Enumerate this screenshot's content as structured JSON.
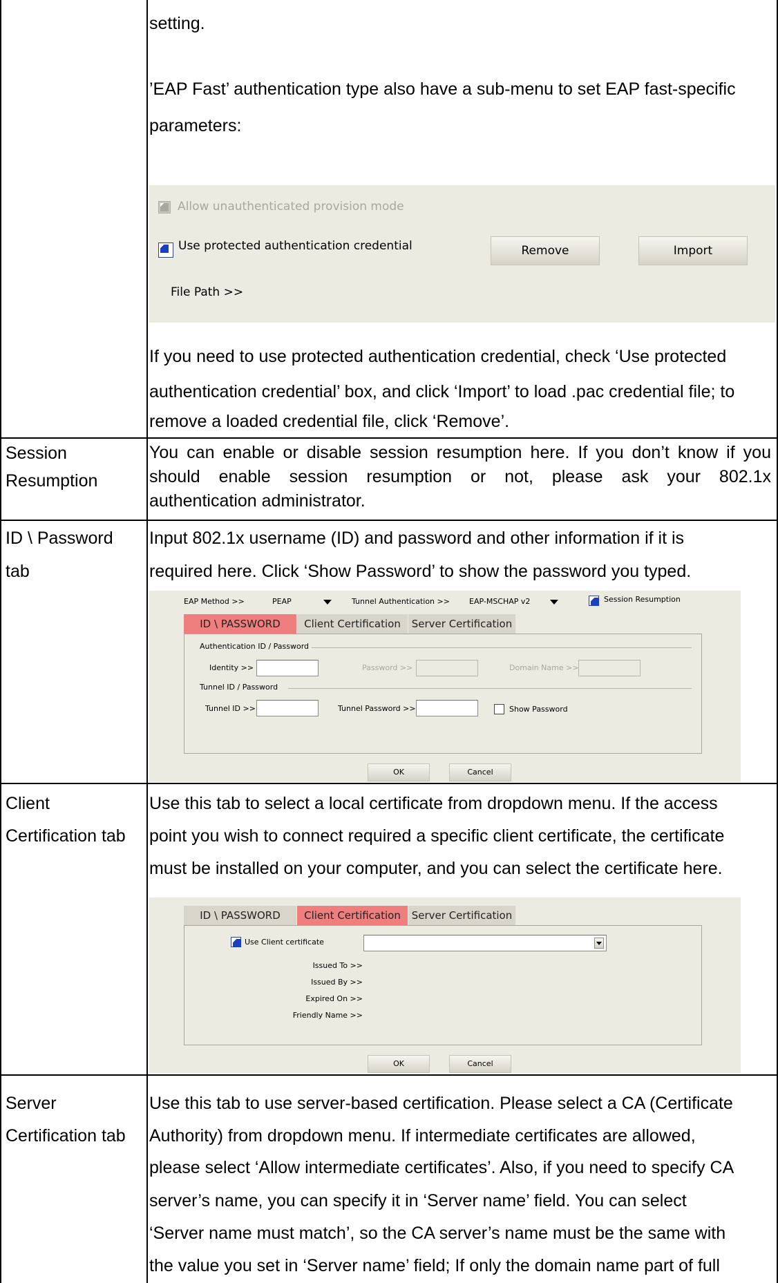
{
  "rows": {
    "eap_fast": {
      "lines": [
        "setting.",
        "’EAP Fast’ authentication type also have a sub-menu to set EAP fast-specific",
        "parameters:"
      ],
      "after_lines": [
        "If you need to use protected authentication credential, check ‘Use protected",
        "authentication credential’ box, and click ‘Import’ to load .pac credential file; to",
        "remove a loaded credential file, click ‘Remove’."
      ]
    },
    "session": {
      "label": [
        "Session",
        "Resumption"
      ],
      "lines": [
        "You can enable or disable session resumption here. If you don’t know if you",
        "should enable session resumption or not, please ask your 802.1x",
        "authentication administrator."
      ]
    },
    "id_password": {
      "label": [
        "ID \\ Password",
        "tab"
      ],
      "lines": [
        "Input 802.1x username (ID) and password and other information if it is",
        "required here. Click ‘Show Password’ to show the password you typed."
      ]
    },
    "client_cert": {
      "label": [
        "Client",
        "Certification tab"
      ],
      "lines": [
        "Use this tab to select a local certificate from dropdown menu. If the access",
        "point you wish to connect required a specific client certificate, the certificate",
        "must be installed on your computer, and you can select the certificate here."
      ]
    },
    "server_cert": {
      "label": [
        "Server",
        "Certification tab"
      ],
      "lines": [
        "Use this tab to use server-based certification. Please select a CA (Certificate",
        "Authority) from dropdown menu. If intermediate certificates are allowed,",
        "please select ‘Allow intermediate certificates’. Also, if you need to specify CA",
        "server’s name, you can specify it in ‘Server name’ field. You can select",
        "‘Server name must match’, so the CA server’s name must be the same with",
        "the value you set in ‘Server name’ field; If only the domain name part of full"
      ]
    }
  },
  "eap_fast_panel": {
    "allow_unauth": "Allow unauthenticated provision mode",
    "use_protected": "Use protected authentication credential",
    "remove": "Remove",
    "import": "Import",
    "file_path": "File Path >>"
  },
  "id_panel": {
    "eap_method_label": "EAP Method >>",
    "eap_method_value": "PEAP",
    "tunnel_auth_label": "Tunnel Authentication >>",
    "tunnel_auth_value": "EAP-MSCHAP v2",
    "session_resumption": "Session Resumption",
    "tabs": [
      "ID \\ PASSWORD",
      "Client Certification",
      "Server Certification"
    ],
    "auth_group": "Authentication ID / Password",
    "identity": "Identity >>",
    "password": "Password >>",
    "domain": "Domain Name >>",
    "tunnel_group": "Tunnel ID / Password",
    "tunnel_id": "Tunnel ID >>",
    "tunnel_password": "Tunnel Password >>",
    "show_password": "Show Password",
    "ok": "OK",
    "cancel": "Cancel"
  },
  "client_panel": {
    "tabs": [
      "ID \\ PASSWORD",
      "Client Certification",
      "Server Certification"
    ],
    "use_client_cert": "Use Client certificate",
    "issued_to": "Issued To >>",
    "issued_by": "Issued By >>",
    "expired_on": "Expired On >>",
    "friendly_name": "Friendly Name >>",
    "ok": "OK",
    "cancel": "Cancel"
  }
}
